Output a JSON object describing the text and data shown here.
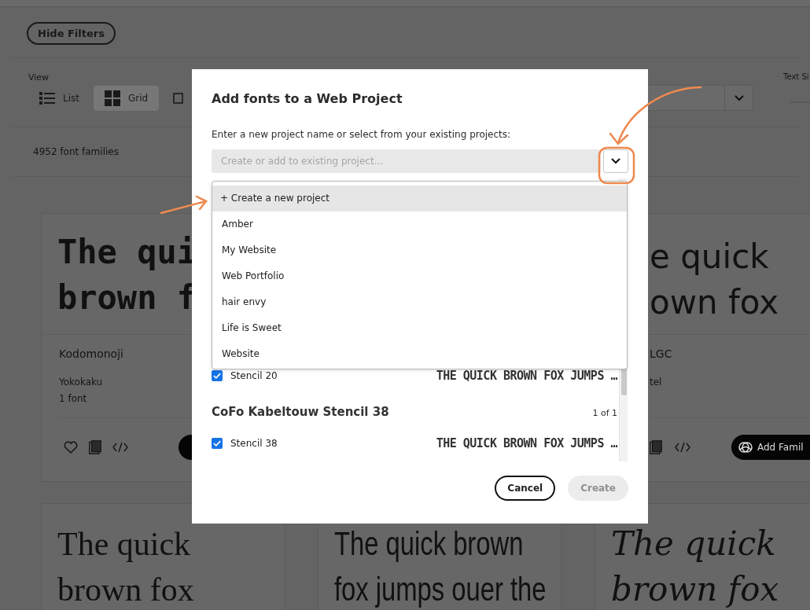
{
  "filter_bar": {
    "hide_filters": "Hide Filters"
  },
  "view": {
    "label": "View",
    "options": [
      {
        "kind": "list",
        "label": "List",
        "selected": false
      },
      {
        "kind": "grid",
        "label": "Grid",
        "selected": true
      },
      {
        "kind": "tile",
        "selected": false
      }
    ]
  },
  "text_size": {
    "label": "Text Si"
  },
  "family_count": "4952 font families",
  "font_cards": [
    {
      "kind": "full",
      "preview": {
        "kind": "handwriting",
        "lines": [
          "The qui",
          "brown f"
        ]
      },
      "name": "Kodomonoji",
      "foundry": "Yokokaku",
      "count": "1 font"
    },
    {
      "kind": "partial",
      "preview": {
        "kind": "humanist",
        "lines": [
          "e quick",
          "own fox"
        ]
      },
      "name": "LGC",
      "foundry": "tel",
      "add_button_label": "Add Famil"
    },
    {
      "kind": "full",
      "preview": {
        "kind": "serif",
        "lines": [
          "The quick",
          "brown fox"
        ]
      }
    },
    {
      "kind": "full",
      "preview": {
        "kind": "condensed",
        "lines": [
          "The quick brown",
          "fox jumps ouer the"
        ]
      }
    },
    {
      "kind": "full",
      "preview": {
        "kind": "italic",
        "lines": [
          "The quick",
          "brown fox"
        ]
      }
    }
  ],
  "dialog": {
    "title": "Add fonts to a Web Project",
    "prompt": "Enter a new project name or select from your existing projects:",
    "project_field": {
      "placeholder": "Create or add to existing project..."
    },
    "project_menu": [
      {
        "label": "+ Create a new project",
        "selected": true
      },
      {
        "label": "Amber",
        "selected": false
      },
      {
        "label": "My Website",
        "selected": false
      },
      {
        "label": "Web Portfolio",
        "selected": false
      },
      {
        "label": "hair envy",
        "selected": false
      },
      {
        "label": "Life is Sweet",
        "selected": false
      },
      {
        "label": "Website",
        "selected": false
      }
    ],
    "font_list": [
      {
        "kind": "font",
        "label": "Stencil 20",
        "checked": true,
        "sample": "THE QUICK BROWN FOX JUMPS …"
      },
      {
        "kind": "family",
        "label": "CoFo Kabeltouw Stencil 38",
        "count": "1 of 1"
      },
      {
        "kind": "font",
        "label": "Stencil 38",
        "checked": true,
        "sample": "THE QUICK BROWN FOX JUMPS …"
      }
    ],
    "buttons": [
      {
        "kind": "secondary",
        "label": "Cancel",
        "disabled": false
      },
      {
        "kind": "primary",
        "label": "Create",
        "disabled": true
      }
    ]
  }
}
